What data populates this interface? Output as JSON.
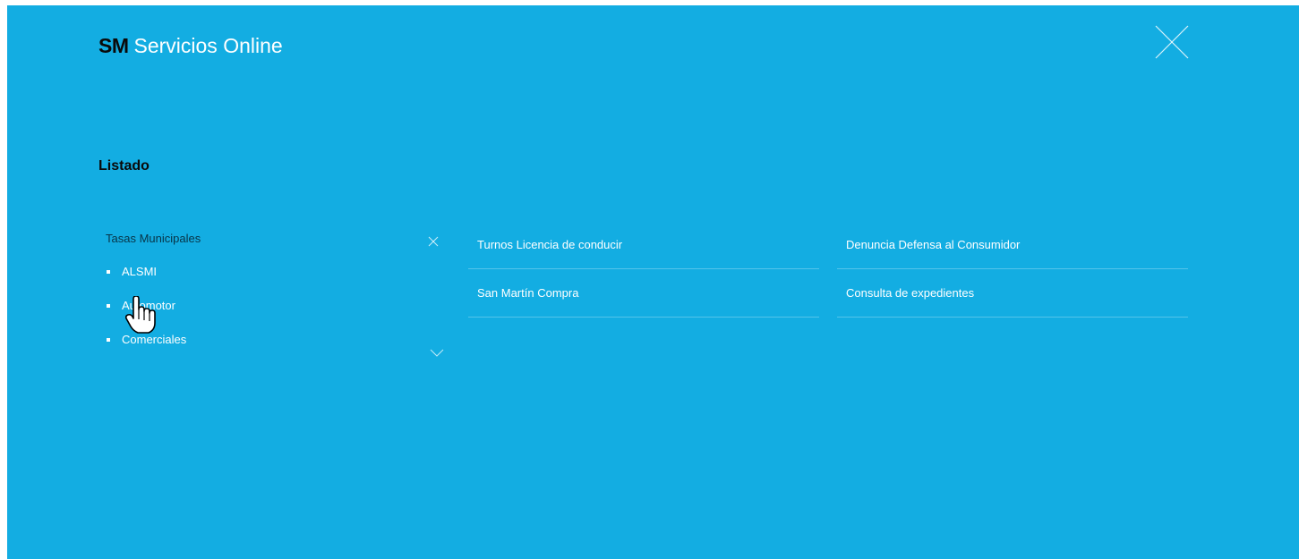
{
  "header": {
    "brand_abbr": "SM",
    "brand_name": "Servicios Online",
    "close_icon": "close-icon"
  },
  "section": {
    "title": "Listado"
  },
  "dropdown": {
    "label": "Tasas Municipales",
    "items": [
      {
        "label": "ALSMI"
      },
      {
        "label": "Automotor"
      },
      {
        "label": "Comerciales"
      }
    ]
  },
  "columns": [
    {
      "items": [
        {
          "label": "Turnos Licencia de conducir"
        },
        {
          "label": "San Martín Compra"
        }
      ]
    },
    {
      "items": [
        {
          "label": "Denuncia Defensa al Consumidor"
        },
        {
          "label": "Consulta de expedientes"
        }
      ]
    }
  ],
  "colors": {
    "panel_bg": "#13ade2",
    "text_light": "#ffffff",
    "text_dark": "#0a0a0a"
  }
}
